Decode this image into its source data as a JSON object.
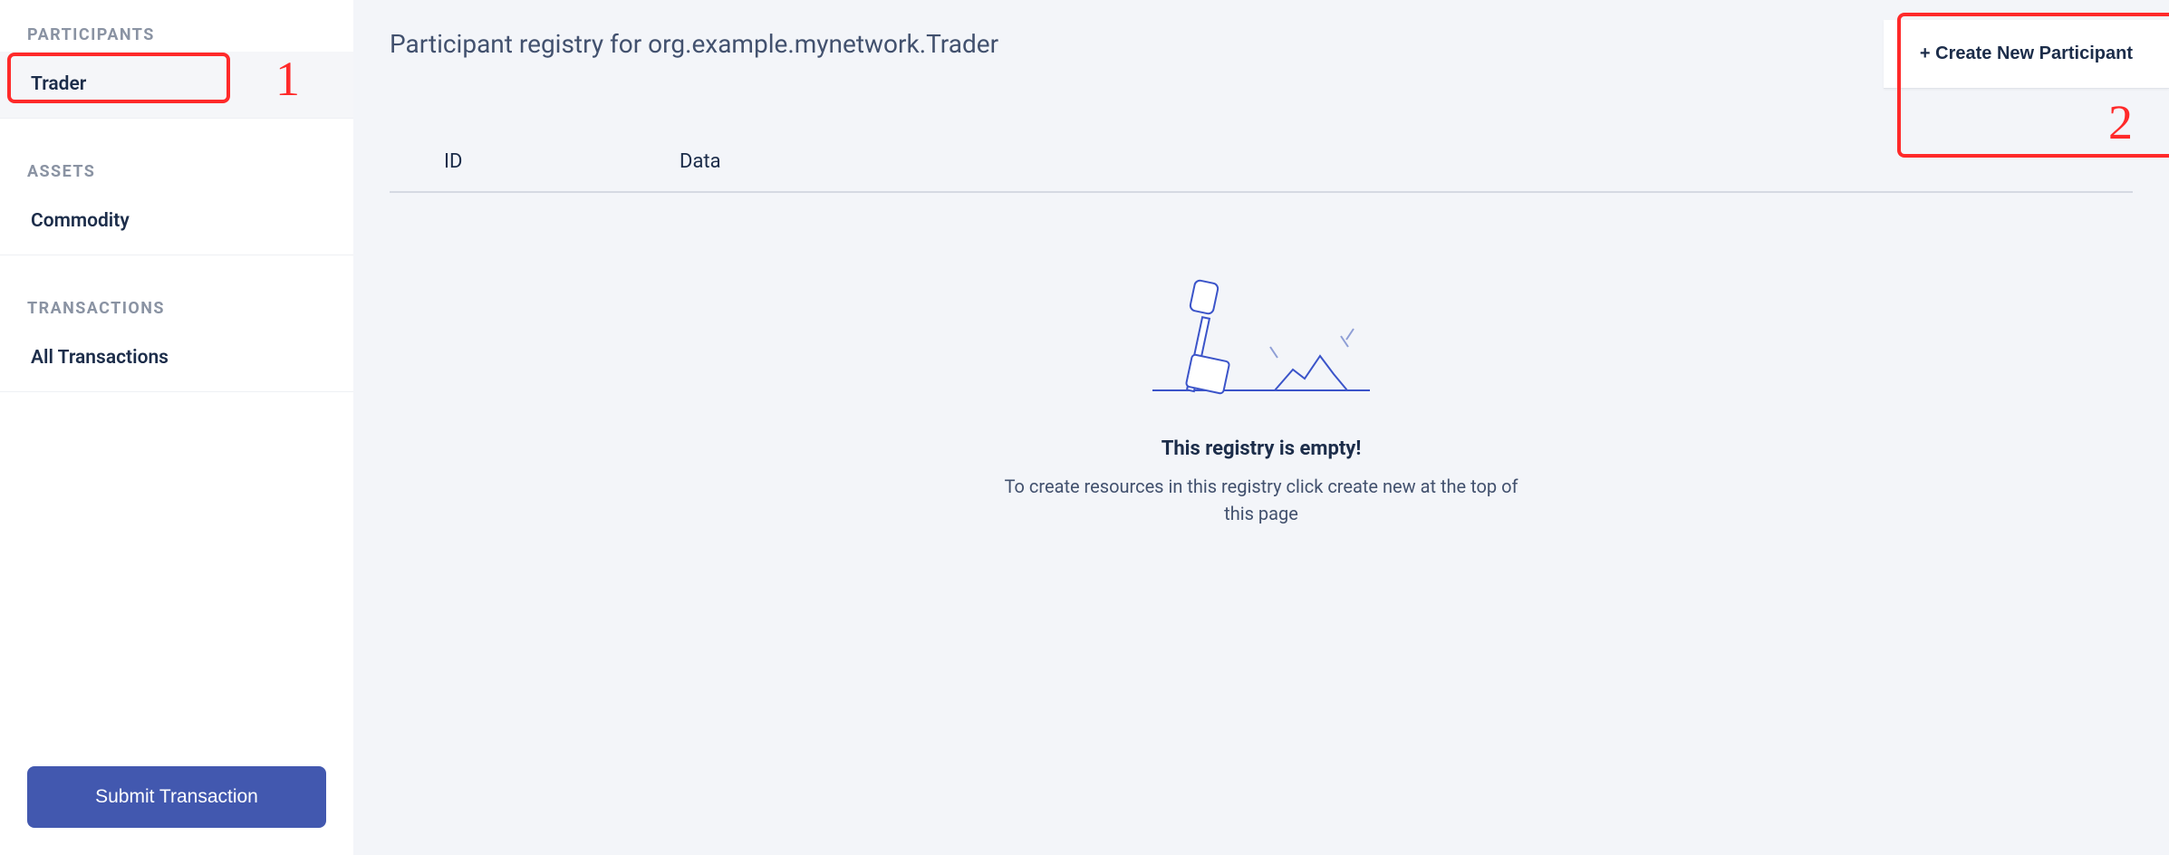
{
  "sidebar": {
    "sections": [
      {
        "header": "PARTICIPANTS",
        "items": [
          {
            "label": "Trader",
            "active": true
          }
        ]
      },
      {
        "header": "ASSETS",
        "items": [
          {
            "label": "Commodity",
            "active": false
          }
        ]
      },
      {
        "header": "TRANSACTIONS",
        "items": [
          {
            "label": "All Transactions",
            "active": false
          }
        ]
      }
    ],
    "submit_label": "Submit Transaction"
  },
  "main": {
    "title": "Participant registry for org.example.mynetwork.Trader",
    "create_label": "+ Create New Participant",
    "columns": {
      "id": "ID",
      "data": "Data"
    },
    "empty": {
      "title": "This registry is empty!",
      "subtitle": "To create resources in this registry click create new at the top of this page"
    }
  },
  "annotations": {
    "one": "1",
    "two": "2"
  }
}
